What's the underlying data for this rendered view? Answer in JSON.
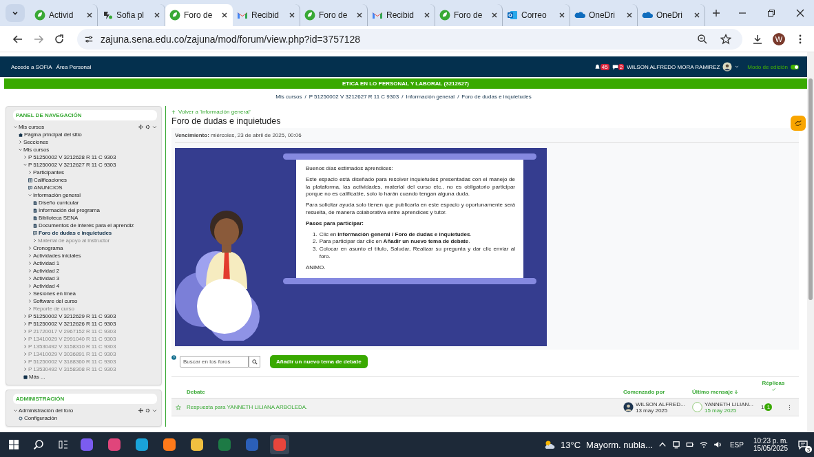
{
  "browser": {
    "tabs": [
      {
        "label": "Activid",
        "kind": "sena",
        "selected": false
      },
      {
        "label": "Sofia pl",
        "kind": "sofia",
        "selected": false
      },
      {
        "label": "Foro de",
        "kind": "sena",
        "selected": true
      },
      {
        "label": "Recibid",
        "kind": "gmail",
        "selected": false
      },
      {
        "label": "Foro de",
        "kind": "sena",
        "selected": false
      },
      {
        "label": "Recibid",
        "kind": "gmail",
        "selected": false
      },
      {
        "label": "Foro de",
        "kind": "sena",
        "selected": false
      },
      {
        "label": "Correo",
        "kind": "outlook",
        "selected": false
      },
      {
        "label": "OneDri",
        "kind": "onedrive",
        "selected": false
      },
      {
        "label": "OneDri",
        "kind": "onedrive",
        "selected": false
      }
    ],
    "url": "zajuna.sena.edu.co/zajuna/mod/forum/view.php?id=3757128",
    "profile": "W"
  },
  "site_header": {
    "links": [
      "Accede a SOFIA",
      "Área Personal"
    ],
    "notifications": [
      {
        "kind": "bell",
        "count": "45"
      },
      {
        "kind": "chat",
        "count": "2"
      }
    ],
    "user": "WILSON ALFREDO MORA RAMIREZ",
    "edit_mode": {
      "label": "Modo de edición",
      "on": true
    }
  },
  "course_bar": "ETICA EN LO PERSONAL Y LABORAL (3212627)",
  "breadcrumb": {
    "separator": "/",
    "items": [
      "Mis cursos",
      "P 51250002 V 3212627 R 11 C 9303",
      "Información general",
      "Foro de dudas e inquietudes"
    ]
  },
  "sidebar": {
    "blocks": [
      {
        "title": "PANEL DE NAVEGACIÓN",
        "tree": [
          {
            "label": "Mis cursos",
            "kind": "branch",
            "expanded": true,
            "dimmed": false,
            "selected": false,
            "children": [
              {
                "label": "Página principal del sitio",
                "kind": "home",
                "dimmed": false,
                "selected": false
              },
              {
                "label": "Secciones",
                "kind": "branch",
                "expanded": false,
                "dimmed": false,
                "selected": false
              },
              {
                "label": "Mis cursos",
                "kind": "branch",
                "expanded": true,
                "dimmed": false,
                "selected": false,
                "children": [
                  {
                    "label": "P 51250002 V 3212628 R 11 C 9303",
                    "kind": "branch",
                    "expanded": false,
                    "dimmed": false,
                    "selected": false
                  },
                  {
                    "label": "P 51250002 V 3212627 R 11 C 9303",
                    "kind": "branch",
                    "expanded": true,
                    "dimmed": false,
                    "selected": false,
                    "children": [
                      {
                        "label": "Participantes",
                        "kind": "branch",
                        "expanded": false,
                        "dimmed": false,
                        "selected": false
                      },
                      {
                        "label": "Calificaciones",
                        "kind": "grades",
                        "dimmed": false,
                        "selected": false
                      },
                      {
                        "label": "ANUNCIOS",
                        "kind": "forum",
                        "dimmed": false,
                        "selected": false
                      },
                      {
                        "label": "Información general",
                        "kind": "branch",
                        "expanded": true,
                        "dimmed": false,
                        "selected": false,
                        "children": [
                          {
                            "label": "Diseño curricular",
                            "kind": "page",
                            "dimmed": false,
                            "selected": false
                          },
                          {
                            "label": "Información del programa",
                            "kind": "page",
                            "dimmed": false,
                            "selected": false
                          },
                          {
                            "label": "Biblioteca SENA",
                            "kind": "page",
                            "dimmed": false,
                            "selected": false
                          },
                          {
                            "label": "Documentos de interés para el aprendiz",
                            "kind": "page",
                            "dimmed": false,
                            "selected": false
                          },
                          {
                            "label": "Foro de dudas e inquietudes",
                            "kind": "forum",
                            "dimmed": false,
                            "selected": true
                          },
                          {
                            "label": "Material de apoyo al instructor",
                            "kind": "branch",
                            "expanded": false,
                            "dimmed": true,
                            "selected": false
                          }
                        ]
                      },
                      {
                        "label": "Cronograma",
                        "kind": "branch",
                        "expanded": false,
                        "dimmed": false,
                        "selected": false
                      },
                      {
                        "label": "Actividades iniciales",
                        "kind": "branch",
                        "expanded": false,
                        "dimmed": false,
                        "selected": false
                      },
                      {
                        "label": "Actividad 1",
                        "kind": "branch",
                        "expanded": false,
                        "dimmed": false,
                        "selected": false
                      },
                      {
                        "label": "Actividad 2",
                        "kind": "branch",
                        "expanded": false,
                        "dimmed": false,
                        "selected": false
                      },
                      {
                        "label": "Actividad 3",
                        "kind": "branch",
                        "expanded": false,
                        "dimmed": false,
                        "selected": false
                      },
                      {
                        "label": "Actividad 4",
                        "kind": "branch",
                        "expanded": false,
                        "dimmed": false,
                        "selected": false
                      },
                      {
                        "label": "Sesiones en línea",
                        "kind": "branch",
                        "expanded": false,
                        "dimmed": false,
                        "selected": false
                      },
                      {
                        "label": "Software del curso",
                        "kind": "branch",
                        "expanded": false,
                        "dimmed": false,
                        "selected": false
                      },
                      {
                        "label": "Reporte de curso",
                        "kind": "branch",
                        "expanded": false,
                        "dimmed": true,
                        "selected": false
                      }
                    ]
                  },
                  {
                    "label": "P 51250002 V 3212629 R 11 C 9303",
                    "kind": "branch",
                    "expanded": false,
                    "dimmed": false,
                    "selected": false
                  },
                  {
                    "label": "P 51250002 V 3212626 R 11 C 9303",
                    "kind": "branch",
                    "expanded": false,
                    "dimmed": false,
                    "selected": false
                  },
                  {
                    "label": "P 21720017 V 2967152 R 11 C 9303",
                    "kind": "branch",
                    "expanded": false,
                    "dimmed": true,
                    "selected": false
                  },
                  {
                    "label": "P 13410029 V 2991040 R 11 C 9303",
                    "kind": "branch",
                    "expanded": false,
                    "dimmed": true,
                    "selected": false
                  },
                  {
                    "label": "P 13530492 V 3158310 R 11 C 9303",
                    "kind": "branch",
                    "expanded": false,
                    "dimmed": true,
                    "selected": false
                  },
                  {
                    "label": "P 13410029 V 3036891 R 11 C 9303",
                    "kind": "branch",
                    "expanded": false,
                    "dimmed": true,
                    "selected": false
                  },
                  {
                    "label": "P 51250002 V 3188360 R 11 C 9303",
                    "kind": "branch",
                    "expanded": false,
                    "dimmed": true,
                    "selected": false
                  },
                  {
                    "label": "P 13530492 V 3158308 R 11 C 9303",
                    "kind": "branch",
                    "expanded": false,
                    "dimmed": true,
                    "selected": false
                  },
                  {
                    "label": "Más ...",
                    "kind": "more",
                    "dimmed": false,
                    "selected": false
                  }
                ]
              }
            ]
          }
        ]
      },
      {
        "title": "ADMINISTRACIÓN",
        "tree": [
          {
            "label": "Administración del foro",
            "kind": "branch",
            "expanded": true,
            "dimmed": false,
            "selected": false,
            "children": [
              {
                "label": "Configuración",
                "kind": "settings",
                "dimmed": false,
                "selected": false
              }
            ]
          }
        ]
      }
    ]
  },
  "main": {
    "back_link": "Volver a 'Información general'",
    "title": "Foro de dudas e inquietudes",
    "due": {
      "label": "Vencimiento:",
      "value": "miércoles, 23 de abril de 2025, 00:06"
    },
    "poster": {
      "greeting": "Buenos días estimados aprendices:",
      "paragraphs": [
        "Este espacio está diseñado para resolver inquietudes presentadas con el manejo de la plataforma, las actividades, material del curso etc., no es obligatorio participar porque no es calificable, solo lo harán cuando tengan alguna duda.",
        "Para solicitar ayuda solo tienen que publicarla en este espacio y oportunamente será resuelta, de manera colaborativa entre aprendices y tutor."
      ],
      "steps_title": "Pasos para participar:",
      "steps": [
        {
          "number": "1.",
          "text": "Clic en **Información general / Foro de dudas e inquietudes**."
        },
        {
          "number": "2.",
          "text": "Para participar dar clic en **Añadir un nuevo tema de debate**."
        },
        {
          "number": "3.",
          "text": "Colocar en asunto el título, Saludar, Realizar su pregunta y dar clic enviar al foro."
        }
      ],
      "closing": "ANIMO."
    },
    "search": {
      "placeholder": "Buscar en los foros"
    },
    "add_button": "Añadir un nuevo tema de debate",
    "table": {
      "columns": [
        "Debate",
        "Comenzado por",
        "Último mensaje",
        "Réplicas"
      ],
      "rows": [
        {
          "starred": false,
          "title": "Respuesta para YANNETH LILIANA ARBOLEDA.",
          "started_by": "WILSON ALFRED...",
          "started_date": "13 may 2025",
          "last_by": "YANNETH LILIAN...",
          "last_date": "15 may 2025",
          "replies": "1",
          "unread": "1"
        }
      ]
    }
  },
  "taskbar": {
    "apps": [
      {
        "kind": "copilot",
        "selected": false
      },
      {
        "kind": "snip",
        "selected": false
      },
      {
        "kind": "edge",
        "selected": false
      },
      {
        "kind": "firefox",
        "selected": false
      },
      {
        "kind": "folder",
        "selected": false
      },
      {
        "kind": "excel",
        "selected": false
      },
      {
        "kind": "word",
        "selected": false
      },
      {
        "kind": "chrome",
        "selected": true
      }
    ],
    "weather": {
      "temp": "13°C",
      "text": "Mayorm. nubla..."
    },
    "language": "ESP",
    "time": "10:23 p. m.",
    "date": "15/05/2025",
    "notifications": "3"
  }
}
